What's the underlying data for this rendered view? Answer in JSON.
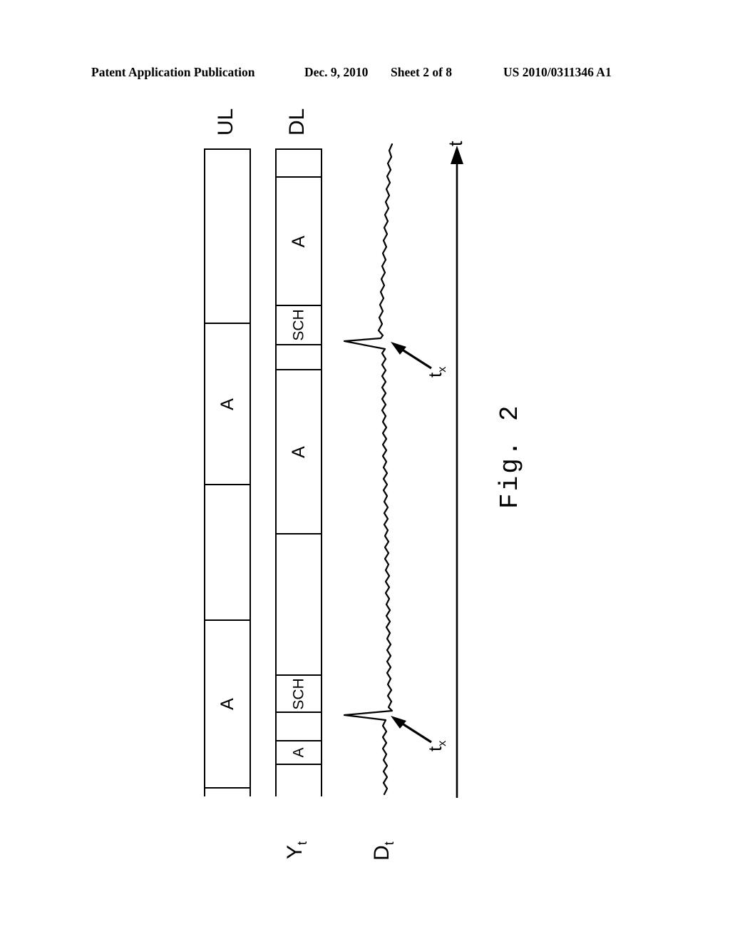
{
  "header": {
    "publication": "Patent Application Publication",
    "date": "Dec. 9, 2010",
    "sheet": "Sheet 2 of 8",
    "publication_number": "US 2010/0311346 A1"
  },
  "figure": {
    "caption": "Fig. 2",
    "axis": {
      "label": "t",
      "direction": "upward-arrow",
      "name": "time-axis"
    },
    "rows": [
      {
        "title": "UL",
        "name": "uplink-bar",
        "segments": [
          {
            "label": "",
            "name": "ul-segment-idle-1"
          },
          {
            "label": "A",
            "name": "ul-segment-a-1"
          },
          {
            "label": "",
            "name": "ul-segment-idle-2"
          },
          {
            "label": "A",
            "name": "ul-segment-a-2"
          },
          {
            "label": "",
            "name": "ul-segment-idle-3"
          }
        ]
      },
      {
        "title": "DL",
        "name": "downlink-bar",
        "segments": [
          {
            "label": "",
            "name": "dl-segment-idle-1"
          },
          {
            "label": "A",
            "name": "dl-segment-a-1"
          },
          {
            "label": "SCH",
            "name": "dl-segment-sch-1"
          },
          {
            "label": "",
            "name": "dl-segment-idle-2"
          },
          {
            "label": "A",
            "name": "dl-segment-a-2"
          },
          {
            "label": "",
            "name": "dl-segment-idle-3"
          },
          {
            "label": "SCH",
            "name": "dl-segment-sch-2"
          },
          {
            "label": "",
            "name": "dl-segment-idle-4"
          },
          {
            "label": "A",
            "name": "dl-segment-a-3"
          },
          {
            "label": "",
            "name": "dl-segment-idle-5"
          }
        ]
      }
    ],
    "signals": [
      {
        "label": "Y",
        "subscript": "t",
        "name": "signal-label-yt"
      },
      {
        "label": "D",
        "subscript": "t",
        "name": "signal-label-dt"
      }
    ],
    "annotations": [
      {
        "label": "t",
        "subscript": "x",
        "name": "annotation-tx-upper"
      },
      {
        "label": "t",
        "subscript": "x",
        "name": "annotation-tx-lower"
      }
    ],
    "colors": {
      "ink": "#000000",
      "paper": "#ffffff"
    }
  }
}
